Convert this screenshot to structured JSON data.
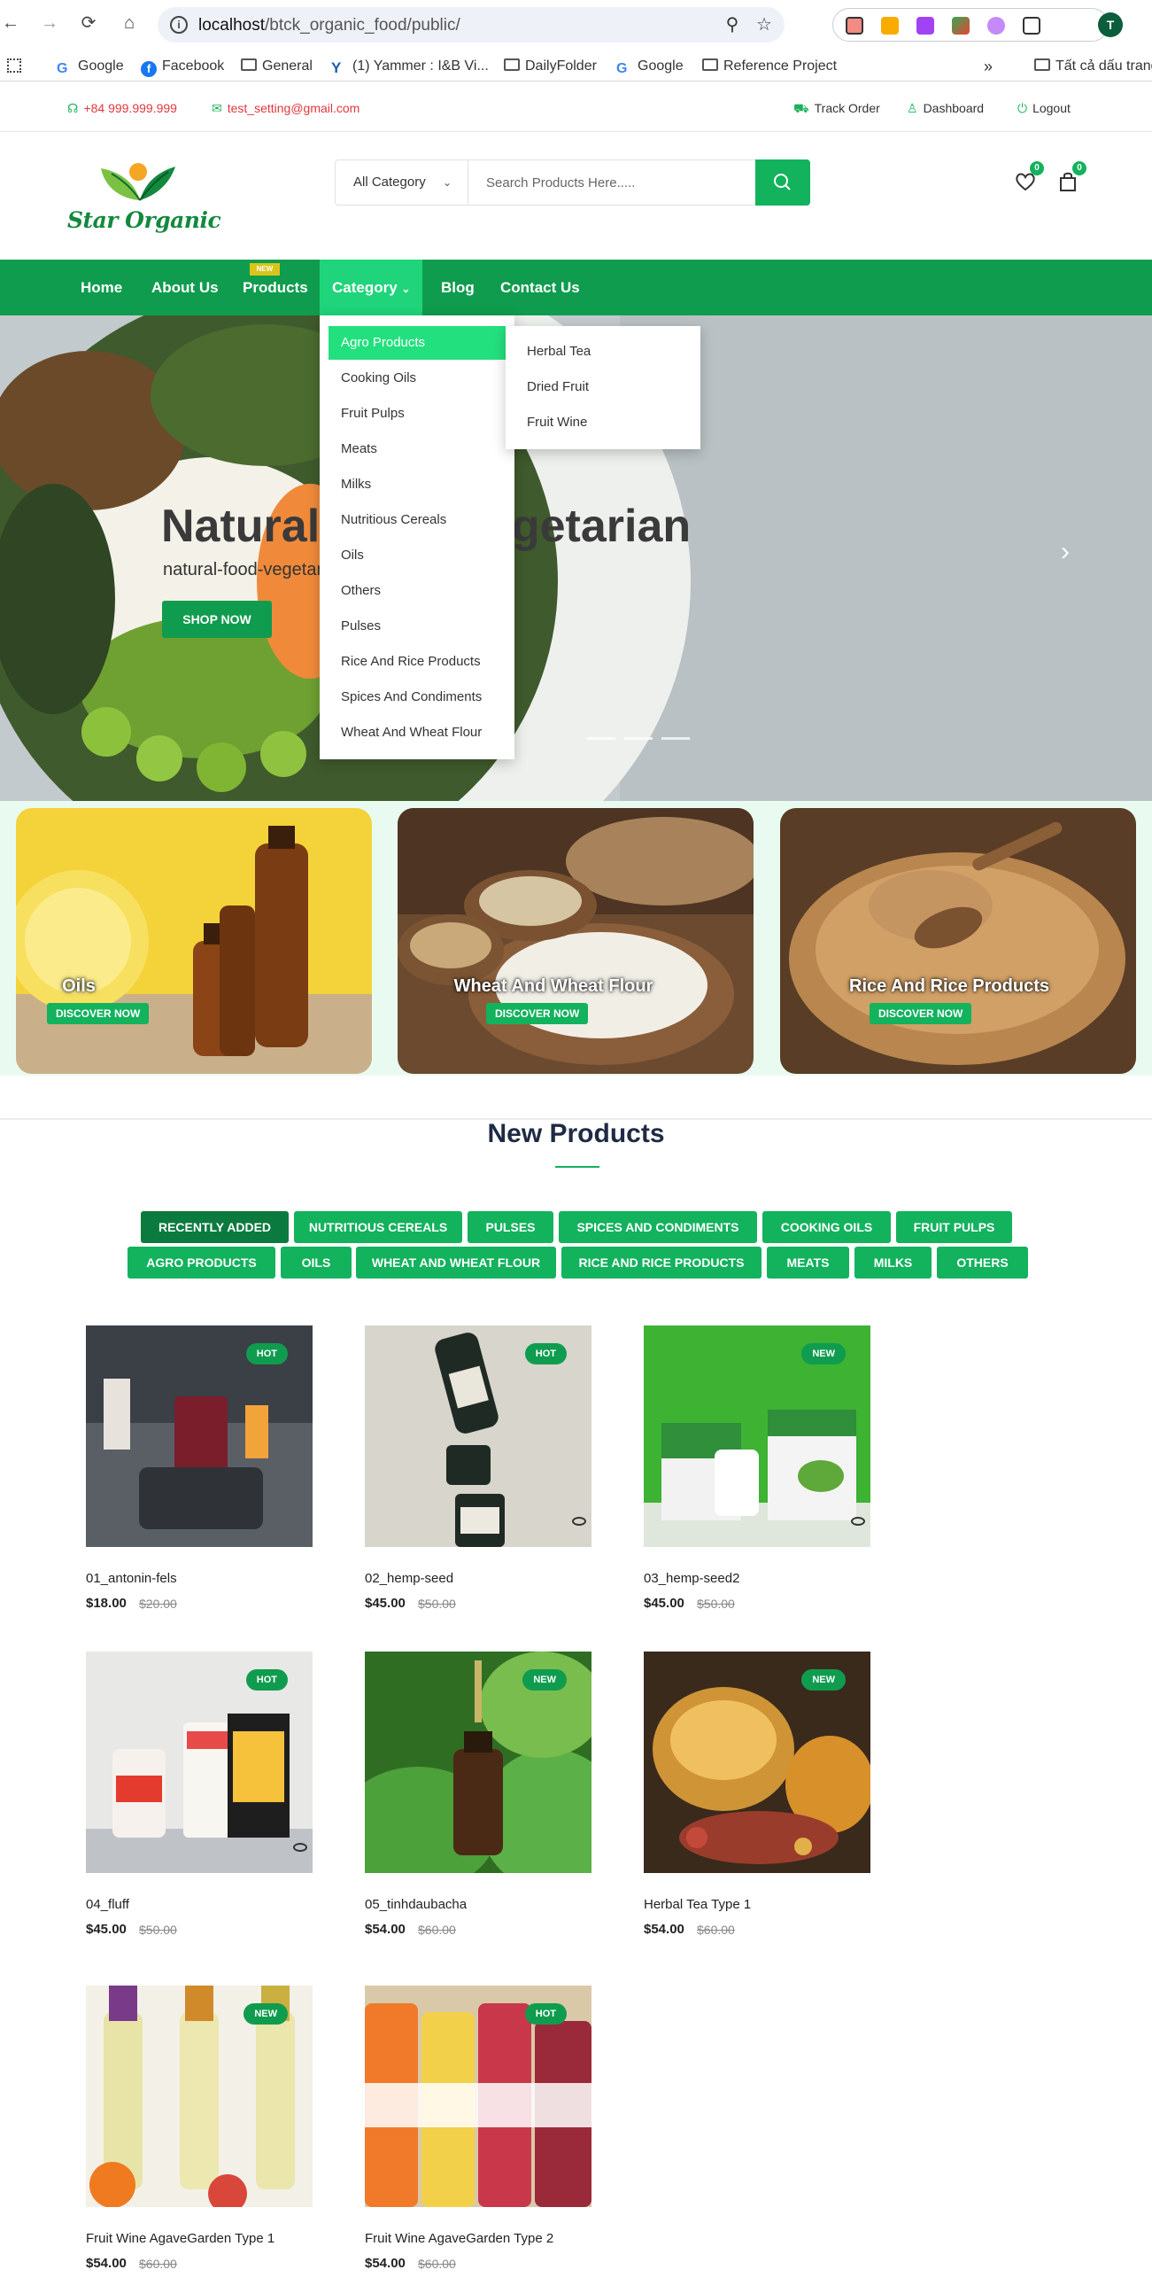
{
  "browser": {
    "url_host": "localhost",
    "url_path": "/btck_organic_food/public/",
    "profile_initial": "T",
    "bookmarks": [
      {
        "label": "Google",
        "icon": "google-icon"
      },
      {
        "label": "Facebook",
        "icon": "facebook-icon"
      },
      {
        "label": "General",
        "icon": "folder-icon"
      },
      {
        "label": "(1) Yammer : I&B Vi...",
        "icon": "yammer-icon"
      },
      {
        "label": "DailyFolder",
        "icon": "folder-icon"
      },
      {
        "label": "Google",
        "icon": "google-icon"
      },
      {
        "label": "Reference Project",
        "icon": "folder-icon"
      },
      {
        "label": "Tất cả dấu trang",
        "icon": "folder-icon"
      }
    ],
    "more_bookmarks": "»"
  },
  "topbar": {
    "phone": "+84 999.999.999",
    "email": "test_setting@gmail.com",
    "track_order": "Track Order",
    "dashboard": "Dashboard",
    "logout": "Logout"
  },
  "header": {
    "logo_text": "Star Organic",
    "category_select": "All Category",
    "search_placeholder": "Search Products Here.....",
    "wishlist_count": "0",
    "cart_count": "0"
  },
  "nav": {
    "items": [
      "Home",
      "About Us",
      "Products",
      "Category",
      "Blog",
      "Contact Us"
    ],
    "new_badge": "NEW",
    "category_caret": "⌄"
  },
  "hero": {
    "title": "Natural Food Vegetarian",
    "subtitle": "natural-food-vegetarian",
    "button": "SHOP NOW",
    "next_arrow": "›"
  },
  "category_menu": {
    "items": [
      "Agro Products",
      "Cooking Oils",
      "Fruit Pulps",
      "Meats",
      "Milks",
      "Nutritious Cereals",
      "Oils",
      "Others",
      "Pulses",
      "Rice And Rice Products",
      "Spices And Condiments",
      "Wheat And Wheat Flour"
    ],
    "active_index": 0,
    "sub_items": [
      "Herbal Tea",
      "Dried Fruit",
      "Fruit Wine"
    ]
  },
  "category_banners": [
    {
      "name": "Oils",
      "button": "DISCOVER NOW"
    },
    {
      "name": "Wheat And Wheat Flour",
      "button": "DISCOVER NOW"
    },
    {
      "name": "Rice And Rice Products",
      "button": "DISCOVER NOW"
    }
  ],
  "new_products": {
    "title": "New Products",
    "tabs_row1": [
      "RECENTLY ADDED",
      "NUTRITIOUS CEREALS",
      "PULSES",
      "SPICES AND CONDIMENTS",
      "COOKING OILS",
      "FRUIT PULPS"
    ],
    "tabs_row2": [
      "AGRO PRODUCTS",
      "OILS",
      "WHEAT AND WHEAT FLOUR",
      "RICE AND RICE PRODUCTS",
      "MEATS",
      "MILKS",
      "OTHERS"
    ],
    "active_tab": "RECENTLY ADDED",
    "products": [
      {
        "name": "01_antonin-fels",
        "price": "$18.00",
        "old_price": "$20.00",
        "tag": "HOT"
      },
      {
        "name": "02_hemp-seed",
        "price": "$45.00",
        "old_price": "$50.00",
        "tag": "HOT"
      },
      {
        "name": "03_hemp-seed2",
        "price": "$45.00",
        "old_price": "$50.00",
        "tag": "NEW"
      },
      {
        "name": "04_fluff",
        "price": "$45.00",
        "old_price": "$50.00",
        "tag": "HOT"
      },
      {
        "name": "05_tinhdaubacha",
        "price": "$54.00",
        "old_price": "$60.00",
        "tag": "NEW"
      },
      {
        "name": "Herbal Tea Type 1",
        "price": "$54.00",
        "old_price": "$60.00",
        "tag": "NEW"
      },
      {
        "name": "Fruit Wine AgaveGarden Type 1",
        "price": "$54.00",
        "old_price": "$60.00",
        "tag": "NEW"
      },
      {
        "name": "Fruit Wine AgaveGarden Type 2",
        "price": "$54.00",
        "old_price": "$60.00",
        "tag": "HOT"
      }
    ]
  },
  "colors": {
    "brand_green": "#0f9c4e",
    "accent_green": "#13b25d",
    "active_green": "#1fd47a",
    "contact_red": "#e0383e"
  }
}
